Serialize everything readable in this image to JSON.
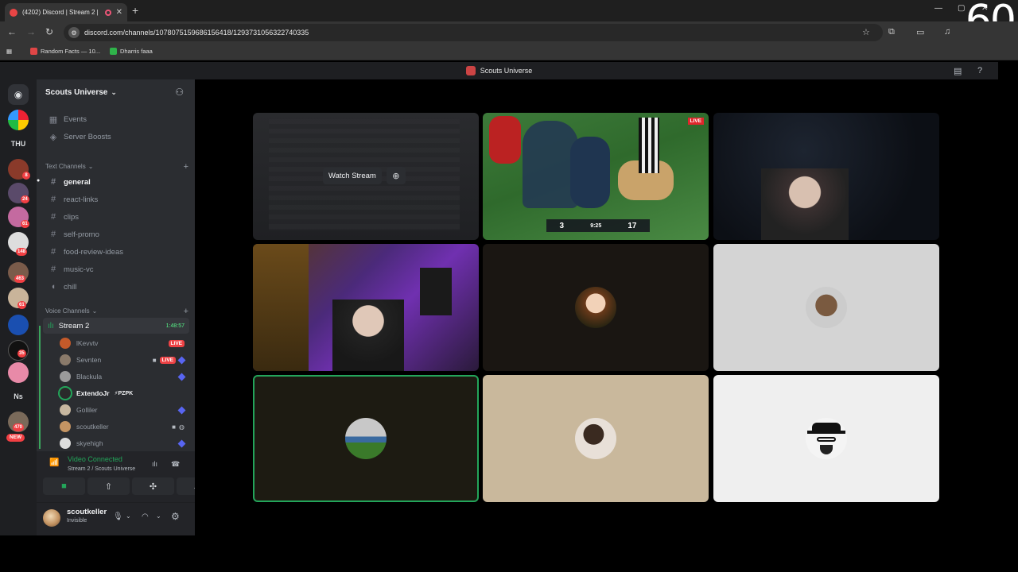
{
  "browser": {
    "tab_title": "(4202) Discord | Stream 2 |",
    "url": "discord.com/channels/1078075159686156418/1293731056322740335",
    "bookmarks": [
      "Random Facts — 10...",
      "Dharris faaa"
    ],
    "fps_overlay": "60"
  },
  "discord": {
    "window_title": "Scouts Universe",
    "server_name": "Scouts Universe",
    "rail": {
      "text_labels": [
        "THU",
        "Ns",
        "NEW"
      ],
      "badges": [
        "8",
        "24",
        "61",
        "148",
        "463",
        "61",
        "35",
        "470"
      ]
    },
    "sidebar": {
      "top_items": [
        {
          "label": "Events"
        },
        {
          "label": "Server Boosts"
        }
      ],
      "text_category": "Text Channels",
      "text_channels": [
        {
          "label": "general"
        },
        {
          "label": "react-links"
        },
        {
          "label": "clips"
        },
        {
          "label": "self-promo"
        },
        {
          "label": "food-review-ideas"
        },
        {
          "label": "music-vc"
        },
        {
          "label": "chill"
        }
      ],
      "voice_category": "Voice Channels",
      "voice_channel": {
        "label": "Stream 2",
        "timer": "1:48:57"
      },
      "voice_users": [
        {
          "name": "lKevvtv",
          "live": "LIVE"
        },
        {
          "name": "Sevnten",
          "live": "LIVE"
        },
        {
          "name": "Blackula"
        },
        {
          "name": "ExtendoJr",
          "tag": "⚡PZPK"
        },
        {
          "name": "Golliler"
        },
        {
          "name": "scoutkeller"
        },
        {
          "name": "skyehigh"
        }
      ]
    },
    "voice_connected": {
      "status": "Video Connected",
      "location": "Stream 2 / Scouts Universe"
    },
    "user_panel": {
      "username": "scoutkeller",
      "status": "Invisible"
    },
    "stage": {
      "watch_stream_label": "Watch Stream",
      "live_badge": "LIVE",
      "scoreboard": [
        "3",
        "9:25",
        "17"
      ]
    }
  },
  "colors": {
    "accent_green": "#23a55a",
    "live_red": "#ed4245",
    "sidebar_bg": "#2b2d31",
    "rail_bg": "#1e1f22"
  }
}
